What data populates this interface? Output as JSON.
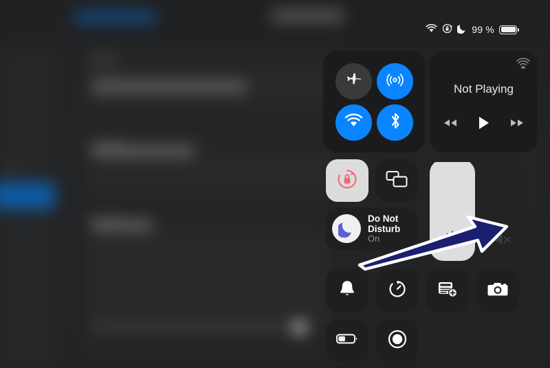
{
  "status_bar": {
    "wifi_icon": "wifi-icon",
    "rotation_lock_icon": "rotation-lock-icon",
    "do_not_disturb_icon": "moon-icon",
    "battery_percent": "99 %",
    "battery_icon": "battery-icon"
  },
  "control_center": {
    "connectivity": {
      "airplane_mode": {
        "icon": "airplane-icon",
        "state": "off"
      },
      "airdrop": {
        "icon": "airdrop-icon",
        "state": "on"
      },
      "wifi": {
        "icon": "wifi-icon",
        "state": "on"
      },
      "bluetooth": {
        "icon": "bluetooth-icon",
        "state": "on"
      }
    },
    "media": {
      "title": "Not Playing",
      "airplay_icon": "airplay-icon",
      "rewind_icon": "rewind-icon",
      "play_icon": "play-icon",
      "forward_icon": "forward-icon"
    },
    "rotation_lock": {
      "icon": "rotation-lock-icon",
      "state": "on"
    },
    "screen_mirroring": {
      "icon": "screen-mirroring-icon",
      "state": "off"
    },
    "do_not_disturb": {
      "icon": "moon-icon",
      "label": "Do Not Disturb",
      "state": "On"
    },
    "brightness": {
      "icon": "brightness-sun-icon",
      "level_percent": 97
    },
    "volume": {
      "icon": "volume-muted-icon",
      "level_percent": 0
    },
    "toggles": [
      {
        "name": "alarm",
        "icon": "bell-icon"
      },
      {
        "name": "timer",
        "icon": "timer-icon"
      },
      {
        "name": "notes",
        "icon": "note-add-icon"
      },
      {
        "name": "camera",
        "icon": "camera-icon"
      },
      {
        "name": "low-power-mode",
        "icon": "battery-icon"
      },
      {
        "name": "screen-recording",
        "icon": "record-icon"
      }
    ]
  },
  "annotation": {
    "arrow_color": "#1b1f70",
    "arrow_outline_color": "#ffffff",
    "points_at": "volume-muted-icon"
  },
  "colors": {
    "accent_blue": "#0a84ff",
    "module_background": "#1b1b1d",
    "tile_background": "#1f1f21",
    "active_tile": "#dcdcdc",
    "rotation_lock_red": "#f4666f",
    "dnd_moon_purple": "#5d5fd6"
  }
}
